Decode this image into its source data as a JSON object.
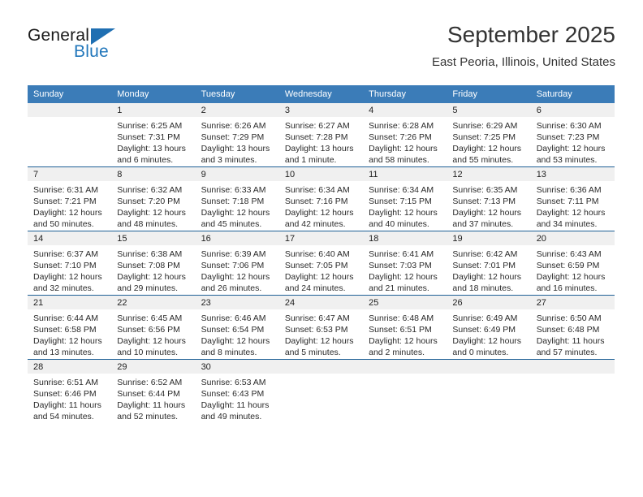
{
  "logo": {
    "word_top": "General",
    "word_bottom": "Blue",
    "triangle_icon": "triangle-icon",
    "brand_blue": "#2277bb",
    "triangle_blue": "#1f6fb2"
  },
  "header": {
    "title": "September 2025",
    "subtitle": "East Peoria, Illinois, United States"
  },
  "theme": {
    "header_row_bg": "#3b7cb8",
    "header_row_text": "#ffffff",
    "daynum_band_bg": "#f0f0f0",
    "row_divider": "#1f6096",
    "body_text": "#2a2a2a"
  },
  "weekdays": [
    "Sunday",
    "Monday",
    "Tuesday",
    "Wednesday",
    "Thursday",
    "Friday",
    "Saturday"
  ],
  "weeks": [
    [
      {
        "day": "",
        "lines": []
      },
      {
        "day": "1",
        "lines": [
          "Sunrise: 6:25 AM",
          "Sunset: 7:31 PM",
          "Daylight: 13 hours",
          "and 6 minutes."
        ]
      },
      {
        "day": "2",
        "lines": [
          "Sunrise: 6:26 AM",
          "Sunset: 7:29 PM",
          "Daylight: 13 hours",
          "and 3 minutes."
        ]
      },
      {
        "day": "3",
        "lines": [
          "Sunrise: 6:27 AM",
          "Sunset: 7:28 PM",
          "Daylight: 13 hours",
          "and 1 minute."
        ]
      },
      {
        "day": "4",
        "lines": [
          "Sunrise: 6:28 AM",
          "Sunset: 7:26 PM",
          "Daylight: 12 hours",
          "and 58 minutes."
        ]
      },
      {
        "day": "5",
        "lines": [
          "Sunrise: 6:29 AM",
          "Sunset: 7:25 PM",
          "Daylight: 12 hours",
          "and 55 minutes."
        ]
      },
      {
        "day": "6",
        "lines": [
          "Sunrise: 6:30 AM",
          "Sunset: 7:23 PM",
          "Daylight: 12 hours",
          "and 53 minutes."
        ]
      }
    ],
    [
      {
        "day": "7",
        "lines": [
          "Sunrise: 6:31 AM",
          "Sunset: 7:21 PM",
          "Daylight: 12 hours",
          "and 50 minutes."
        ]
      },
      {
        "day": "8",
        "lines": [
          "Sunrise: 6:32 AM",
          "Sunset: 7:20 PM",
          "Daylight: 12 hours",
          "and 48 minutes."
        ]
      },
      {
        "day": "9",
        "lines": [
          "Sunrise: 6:33 AM",
          "Sunset: 7:18 PM",
          "Daylight: 12 hours",
          "and 45 minutes."
        ]
      },
      {
        "day": "10",
        "lines": [
          "Sunrise: 6:34 AM",
          "Sunset: 7:16 PM",
          "Daylight: 12 hours",
          "and 42 minutes."
        ]
      },
      {
        "day": "11",
        "lines": [
          "Sunrise: 6:34 AM",
          "Sunset: 7:15 PM",
          "Daylight: 12 hours",
          "and 40 minutes."
        ]
      },
      {
        "day": "12",
        "lines": [
          "Sunrise: 6:35 AM",
          "Sunset: 7:13 PM",
          "Daylight: 12 hours",
          "and 37 minutes."
        ]
      },
      {
        "day": "13",
        "lines": [
          "Sunrise: 6:36 AM",
          "Sunset: 7:11 PM",
          "Daylight: 12 hours",
          "and 34 minutes."
        ]
      }
    ],
    [
      {
        "day": "14",
        "lines": [
          "Sunrise: 6:37 AM",
          "Sunset: 7:10 PM",
          "Daylight: 12 hours",
          "and 32 minutes."
        ]
      },
      {
        "day": "15",
        "lines": [
          "Sunrise: 6:38 AM",
          "Sunset: 7:08 PM",
          "Daylight: 12 hours",
          "and 29 minutes."
        ]
      },
      {
        "day": "16",
        "lines": [
          "Sunrise: 6:39 AM",
          "Sunset: 7:06 PM",
          "Daylight: 12 hours",
          "and 26 minutes."
        ]
      },
      {
        "day": "17",
        "lines": [
          "Sunrise: 6:40 AM",
          "Sunset: 7:05 PM",
          "Daylight: 12 hours",
          "and 24 minutes."
        ]
      },
      {
        "day": "18",
        "lines": [
          "Sunrise: 6:41 AM",
          "Sunset: 7:03 PM",
          "Daylight: 12 hours",
          "and 21 minutes."
        ]
      },
      {
        "day": "19",
        "lines": [
          "Sunrise: 6:42 AM",
          "Sunset: 7:01 PM",
          "Daylight: 12 hours",
          "and 18 minutes."
        ]
      },
      {
        "day": "20",
        "lines": [
          "Sunrise: 6:43 AM",
          "Sunset: 6:59 PM",
          "Daylight: 12 hours",
          "and 16 minutes."
        ]
      }
    ],
    [
      {
        "day": "21",
        "lines": [
          "Sunrise: 6:44 AM",
          "Sunset: 6:58 PM",
          "Daylight: 12 hours",
          "and 13 minutes."
        ]
      },
      {
        "day": "22",
        "lines": [
          "Sunrise: 6:45 AM",
          "Sunset: 6:56 PM",
          "Daylight: 12 hours",
          "and 10 minutes."
        ]
      },
      {
        "day": "23",
        "lines": [
          "Sunrise: 6:46 AM",
          "Sunset: 6:54 PM",
          "Daylight: 12 hours",
          "and 8 minutes."
        ]
      },
      {
        "day": "24",
        "lines": [
          "Sunrise: 6:47 AM",
          "Sunset: 6:53 PM",
          "Daylight: 12 hours",
          "and 5 minutes."
        ]
      },
      {
        "day": "25",
        "lines": [
          "Sunrise: 6:48 AM",
          "Sunset: 6:51 PM",
          "Daylight: 12 hours",
          "and 2 minutes."
        ]
      },
      {
        "day": "26",
        "lines": [
          "Sunrise: 6:49 AM",
          "Sunset: 6:49 PM",
          "Daylight: 12 hours",
          "and 0 minutes."
        ]
      },
      {
        "day": "27",
        "lines": [
          "Sunrise: 6:50 AM",
          "Sunset: 6:48 PM",
          "Daylight: 11 hours",
          "and 57 minutes."
        ]
      }
    ],
    [
      {
        "day": "28",
        "lines": [
          "Sunrise: 6:51 AM",
          "Sunset: 6:46 PM",
          "Daylight: 11 hours",
          "and 54 minutes."
        ]
      },
      {
        "day": "29",
        "lines": [
          "Sunrise: 6:52 AM",
          "Sunset: 6:44 PM",
          "Daylight: 11 hours",
          "and 52 minutes."
        ]
      },
      {
        "day": "30",
        "lines": [
          "Sunrise: 6:53 AM",
          "Sunset: 6:43 PM",
          "Daylight: 11 hours",
          "and 49 minutes."
        ]
      },
      {
        "day": "",
        "lines": []
      },
      {
        "day": "",
        "lines": []
      },
      {
        "day": "",
        "lines": []
      },
      {
        "day": "",
        "lines": []
      }
    ]
  ]
}
